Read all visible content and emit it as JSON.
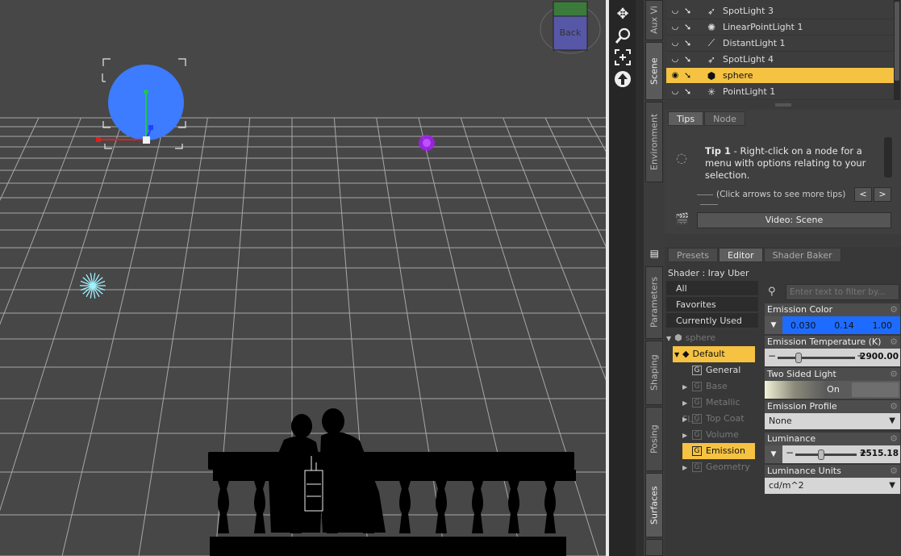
{
  "viewport": {
    "cube_label": "Back"
  },
  "tools": {
    "icons": [
      "move-icon",
      "zoom-icon",
      "frame-icon",
      "orbit-icon"
    ]
  },
  "side_tabs": {
    "aux": "Aux Vi",
    "scene": "Scene",
    "environment": "Environment",
    "parameters": "Parameters",
    "shaping": "Shaping",
    "posing": "Posing",
    "surfaces": "Surfaces"
  },
  "scene_list": {
    "items": [
      {
        "label": "SpotLight 3",
        "icon": "spotlight-icon"
      },
      {
        "label": "LinearPointLight 1",
        "icon": "linear-light-icon"
      },
      {
        "label": "DistantLight 1",
        "icon": "distant-light-icon"
      },
      {
        "label": "SpotLight 4",
        "icon": "spotlight-icon"
      },
      {
        "label": "sphere",
        "icon": "cube-icon",
        "selected": true
      },
      {
        "label": "PointLight 1",
        "icon": "point-light-icon"
      }
    ]
  },
  "tips": {
    "tabs": [
      "Tips",
      "Node"
    ],
    "title": "Tip 1",
    "body": " - Right-click on a node for a menu with options relating to your selection.",
    "hint": "(Click arrows to see more tips)",
    "prev": "<",
    "next": ">",
    "video_button": "Video: Scene"
  },
  "surfaces": {
    "tabs": [
      "Presets",
      "Editor",
      "Shader Baker"
    ],
    "shader": "Shader : Iray Uber",
    "filter_placeholder": "Enter text to filter by...",
    "categories": [
      "All",
      "Favorites",
      "Currently Used"
    ],
    "tree": {
      "root": "sphere",
      "material": "Default",
      "groups": [
        {
          "label": "General",
          "dim": false,
          "expand": false
        },
        {
          "label": "Base",
          "dim": true,
          "expand": true
        },
        {
          "label": "Metallic Fl...",
          "dim": true,
          "expand": true
        },
        {
          "label": "Top Coat",
          "dim": true,
          "expand": true
        },
        {
          "label": "Volume",
          "dim": true,
          "expand": true
        },
        {
          "label": "Emission",
          "dim": false,
          "expand": false,
          "selected": true
        },
        {
          "label": "Geometry",
          "dim": true,
          "expand": true
        }
      ]
    },
    "properties": {
      "emission_color": {
        "label": "Emission Color",
        "r": "0.030",
        "g": "0.14",
        "b": "1.00"
      },
      "emission_temp": {
        "label": "Emission Temperature (K)",
        "value": "2900.00",
        "level": 0.27
      },
      "two_sided": {
        "label": "Two Sided Light",
        "value": "On"
      },
      "profile": {
        "label": "Emission Profile",
        "value": "None"
      },
      "luminance": {
        "label": "Luminance",
        "value": "2515.18",
        "level": 0.42
      },
      "units": {
        "label": "Luminance Units",
        "value": "cd/m^2"
      }
    }
  }
}
